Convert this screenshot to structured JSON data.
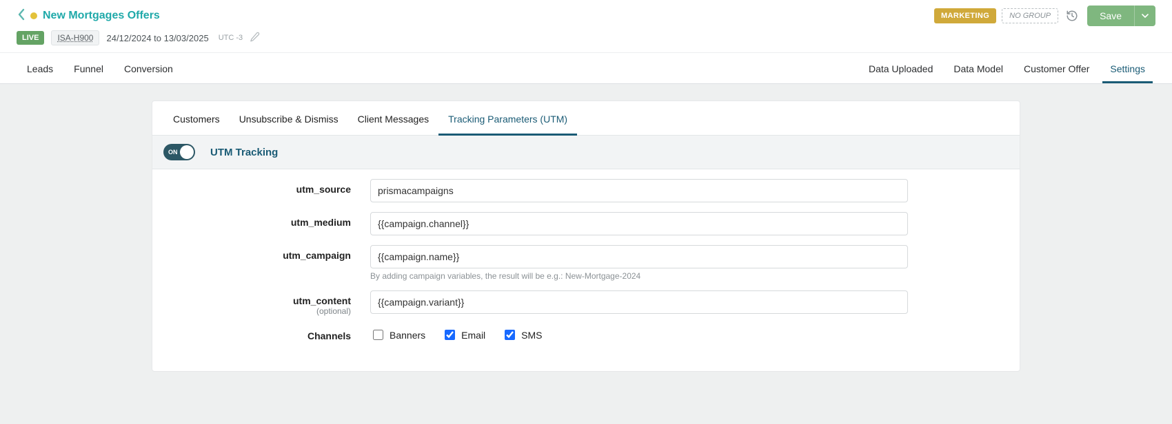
{
  "header": {
    "title": "New Mortgages Offers",
    "marketing_badge": "MARKETING",
    "no_group_badge": "NO GROUP",
    "save_label": "Save",
    "live_badge": "LIVE",
    "tag": "ISA-H900",
    "date_range": "24/12/2024 to 13/03/2025",
    "utc": "UTC -3"
  },
  "main_tabs": {
    "leads": "Leads",
    "funnel": "Funnel",
    "conversion": "Conversion",
    "data_uploaded": "Data Uploaded",
    "data_model": "Data Model",
    "customer_offer": "Customer Offer",
    "settings": "Settings"
  },
  "sub_tabs": {
    "customers": "Customers",
    "unsubscribe": "Unsubscribe & Dismiss",
    "client_messages": "Client Messages",
    "tracking": "Tracking Parameters (UTM)"
  },
  "panel": {
    "toggle_label": "ON",
    "title": "UTM Tracking"
  },
  "form": {
    "utm_source": {
      "label": "utm_source",
      "value": "prismacampaigns"
    },
    "utm_medium": {
      "label": "utm_medium",
      "value": "{{campaign.channel}}"
    },
    "utm_campaign": {
      "label": "utm_campaign",
      "value": "{{campaign.name}}",
      "help": "By adding campaign variables, the result will be e.g.: New-Mortgage-2024"
    },
    "utm_content": {
      "label": "utm_content",
      "sublabel": "(optional)",
      "value": "{{campaign.variant}}"
    },
    "channels": {
      "label": "Channels",
      "banners": "Banners",
      "email": "Email",
      "sms": "SMS"
    }
  }
}
